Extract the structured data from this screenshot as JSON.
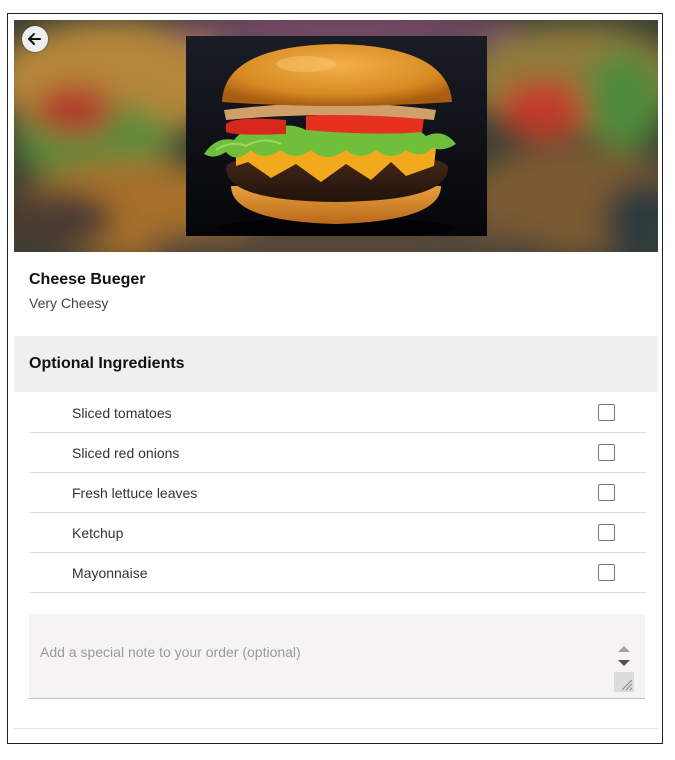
{
  "product": {
    "name": "Cheese Bueger",
    "description": "Very Cheesy"
  },
  "optional_ingredients": {
    "title": "Optional Ingredients",
    "items": [
      {
        "label": "Sliced tomatoes",
        "checked": false
      },
      {
        "label": "Sliced red onions",
        "checked": false
      },
      {
        "label": "Fresh lettuce leaves",
        "checked": false
      },
      {
        "label": "Ketchup",
        "checked": false
      },
      {
        "label": "Mayonnaise",
        "checked": false
      }
    ]
  },
  "special_note": {
    "placeholder": "Add a special note to your order (optional)",
    "value": ""
  },
  "icons": {
    "back": "arrow-left-icon",
    "hero": "burger-photo"
  },
  "colors": {
    "section_header_bg": "#f0f0f0",
    "note_bg": "#f5f4f3",
    "divider": "#dedede"
  }
}
